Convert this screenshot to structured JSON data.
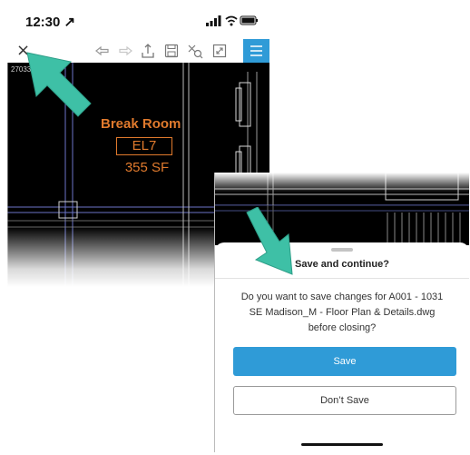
{
  "status_bar": {
    "time": "12:30 ↗"
  },
  "toolbar": {
    "close_label": "×",
    "icons": [
      "undo-icon",
      "redo-icon",
      "share-icon",
      "save-icon",
      "measure-icon",
      "fullscreen-icon",
      "menu-icon"
    ]
  },
  "drawing": {
    "coordinate_label": "27033 ... 82",
    "room_name": "Break Room",
    "room_code": "EL7",
    "room_area": "355 SF"
  },
  "dialog": {
    "title": "Save and continue?",
    "message": "Do you want to save changes for A001 - 1031 SE Madison_M - Floor Plan & Details.dwg before closing?",
    "save_label": "Save",
    "dont_save_label": "Don’t Save"
  },
  "colors": {
    "accent": "#2f9bd7",
    "annotation_arrow": "#3ec0a6",
    "room_text": "#e07a2d"
  }
}
